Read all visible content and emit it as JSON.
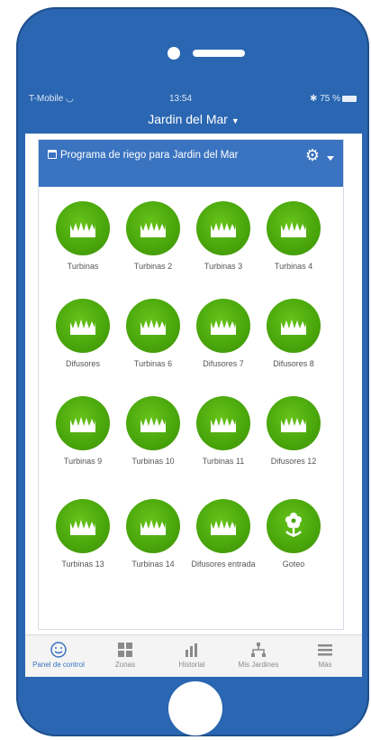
{
  "status_bar": {
    "carrier": "T-Mobile",
    "time": "13:54",
    "battery": "75 %"
  },
  "header": {
    "garden_name": "Jardin del Mar"
  },
  "panel": {
    "title": "Programa de riego para Jardin del Mar"
  },
  "zones": [
    {
      "label": "Turbinas",
      "icon": "grass-icon"
    },
    {
      "label": "Turbinas 2",
      "icon": "grass-icon"
    },
    {
      "label": "Turbinas 3",
      "icon": "grass-icon"
    },
    {
      "label": "Turbinas 4",
      "icon": "grass-icon"
    },
    {
      "label": "Difusores",
      "icon": "grass-icon"
    },
    {
      "label": "Turbinas 6",
      "icon": "grass-icon"
    },
    {
      "label": "Difusores 7",
      "icon": "grass-icon"
    },
    {
      "label": "Difusores 8",
      "icon": "grass-icon"
    },
    {
      "label": "Turbinas 9",
      "icon": "grass-icon"
    },
    {
      "label": "Turbinas 10",
      "icon": "grass-icon"
    },
    {
      "label": "Turbinas 11",
      "icon": "grass-icon"
    },
    {
      "label": "Difusores 12",
      "icon": "grass-icon"
    },
    {
      "label": "Turbinas 13",
      "icon": "grass-icon"
    },
    {
      "label": "Turbinas 14",
      "icon": "grass-icon"
    },
    {
      "label": "Difusores entrada",
      "icon": "grass-icon"
    },
    {
      "label": "Goteo",
      "icon": "flower-icon"
    }
  ],
  "tabs": [
    {
      "label": "Panel de control",
      "icon": "dashboard-icon"
    },
    {
      "label": "Zonas",
      "icon": "grid-icon"
    },
    {
      "label": "Historial",
      "icon": "bar-chart-icon"
    },
    {
      "label": "Mis Jardines",
      "icon": "network-icon"
    },
    {
      "label": "Más",
      "icon": "menu-icon"
    }
  ],
  "colors": {
    "brand_blue": "#2a66b1",
    "panel_header": "#3a73c0",
    "zone_green": "#4ba80c"
  }
}
